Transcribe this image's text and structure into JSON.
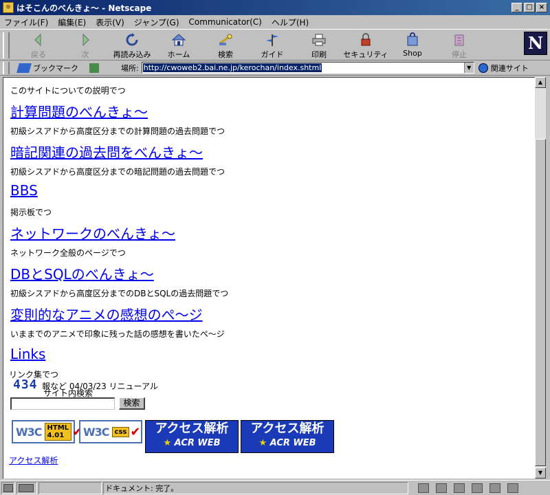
{
  "window": {
    "title": "はそこんのべんきょ～ - Netscape",
    "app_icon_glyph": "※",
    "controls": {
      "minimize": "_",
      "maximize": "□",
      "close": "×"
    }
  },
  "menu": [
    "ファイル(F)",
    "編集(E)",
    "表示(V)",
    "ジャンプ(G)",
    "Communicator(C)",
    "ヘルプ(H)"
  ],
  "toolbar": {
    "buttons": [
      {
        "label": "戻る",
        "icon": "back-arrow-icon",
        "enabled": false
      },
      {
        "label": "次",
        "icon": "forward-arrow-icon",
        "enabled": false
      },
      {
        "label": "再読み込み",
        "icon": "reload-icon",
        "enabled": true
      },
      {
        "label": "ホーム",
        "icon": "home-icon",
        "enabled": true
      },
      {
        "label": "検索",
        "icon": "search-icon",
        "enabled": true
      },
      {
        "label": "ガイド",
        "icon": "guide-icon",
        "enabled": true
      },
      {
        "label": "印刷",
        "icon": "print-icon",
        "enabled": true
      },
      {
        "label": "セキュリティ",
        "icon": "lock-icon",
        "enabled": true
      },
      {
        "label": "Shop",
        "icon": "shop-icon",
        "enabled": true
      },
      {
        "label": "停止",
        "icon": "stop-icon",
        "enabled": false
      }
    ],
    "logo_letter": "N"
  },
  "location": {
    "bookmark_label": "ブックマーク",
    "location_label": "場所:",
    "url": "http://cwoweb2.bai.ne.jp/kerochan/index.shtml",
    "related_label": "関連サイト"
  },
  "page": {
    "intro": "このサイトについての説明でつ",
    "sections": [
      {
        "link": "計算問題のべんきょ～",
        "desc": "初級シスアドから高度区分までの計算問題の過去問題でつ"
      },
      {
        "link": "暗記関連の過去問をべんきょ～",
        "desc": "初級シスアドから高度区分までの暗記問題の過去問題でつ"
      },
      {
        "link": "BBS",
        "desc": "掲示板でつ"
      },
      {
        "link": "ネットワークのべんきょ～",
        "desc": "ネットワーク全般のページでつ"
      },
      {
        "link": "DBとSQLのべんきょ～",
        "desc": "初級シスアドから高度区分までのDBとSQLの過去問題でつ"
      },
      {
        "link": "変則的なアニメの感想のぺ～ジ",
        "desc": "いままでのアニメで印象に残った話の感想を書いたペ～ジ"
      },
      {
        "link": "Links",
        "desc": "リンク集でつ"
      }
    ],
    "counter": "434",
    "update_text": "報など 04/03/23 リニューアル",
    "search_label": "サイト内検索",
    "search_value": "",
    "search_button": "検索",
    "badges": {
      "w3c_logo": "W3C",
      "html_tag": "HTML 4.01",
      "css_tag": "css",
      "check": "✔",
      "acr_line1": "アクセス解析",
      "acr_line2": "ACR WEB",
      "acr_star": "★"
    },
    "footer_link": "アクセス解析"
  },
  "status": {
    "message": "ドキュメント: 完了。"
  }
}
